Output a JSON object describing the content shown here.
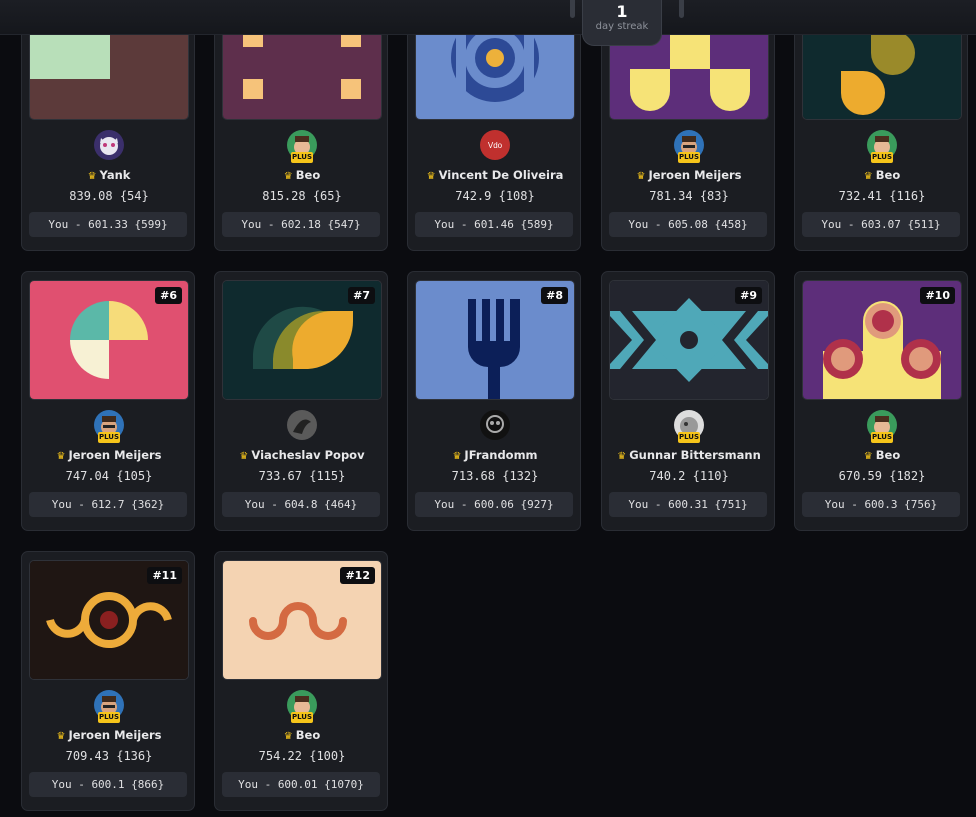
{
  "streak": {
    "count": "1",
    "label": "day streak"
  },
  "cards": [
    {
      "rank": "",
      "user": "Yank",
      "plus": false,
      "score": "839.08 {54}",
      "you": "You - 601.33 {599}"
    },
    {
      "rank": "",
      "user": "Beo",
      "plus": true,
      "score": "815.28 {65}",
      "you": "You - 602.18 {547}"
    },
    {
      "rank": "",
      "user": "Vincent De Oliveira",
      "plus": false,
      "avatar_text": "Vdo",
      "score": "742.9 {108}",
      "you": "You - 601.46 {589}"
    },
    {
      "rank": "",
      "user": "Jeroen Meijers",
      "plus": true,
      "score": "781.34 {83}",
      "you": "You - 605.08 {458}"
    },
    {
      "rank": "",
      "user": "Beo",
      "plus": true,
      "score": "732.41 {116}",
      "you": "You - 603.07 {511}"
    },
    {
      "rank": "#6",
      "user": "Jeroen Meijers",
      "plus": true,
      "score": "747.04 {105}",
      "you": "You - 612.7 {362}"
    },
    {
      "rank": "#7",
      "user": "Viacheslav Popov",
      "plus": false,
      "score": "733.67 {115}",
      "you": "You - 604.8 {464}"
    },
    {
      "rank": "#8",
      "user": "JFrandomm",
      "plus": false,
      "score": "713.68 {132}",
      "you": "You - 600.06 {927}"
    },
    {
      "rank": "#9",
      "user": "Gunnar Bittersmann",
      "plus": true,
      "score": "740.2 {110}",
      "you": "You - 600.31 {751}"
    },
    {
      "rank": "#10",
      "user": "Beo",
      "plus": true,
      "score": "670.59 {182}",
      "you": "You - 600.3 {756}"
    },
    {
      "rank": "#11",
      "user": "Jeroen Meijers",
      "plus": true,
      "score": "709.43 {136}",
      "you": "You - 600.1 {866}"
    },
    {
      "rank": "#12",
      "user": "Beo",
      "plus": true,
      "score": "754.22 {100}",
      "you": "You - 600.01 {1070}"
    }
  ],
  "plus_label": "PLUS",
  "colors": {
    "background": "#0b0c10",
    "card": "#1b1d22",
    "crown": "#f6c51a",
    "you_box": "#2a2d35"
  }
}
